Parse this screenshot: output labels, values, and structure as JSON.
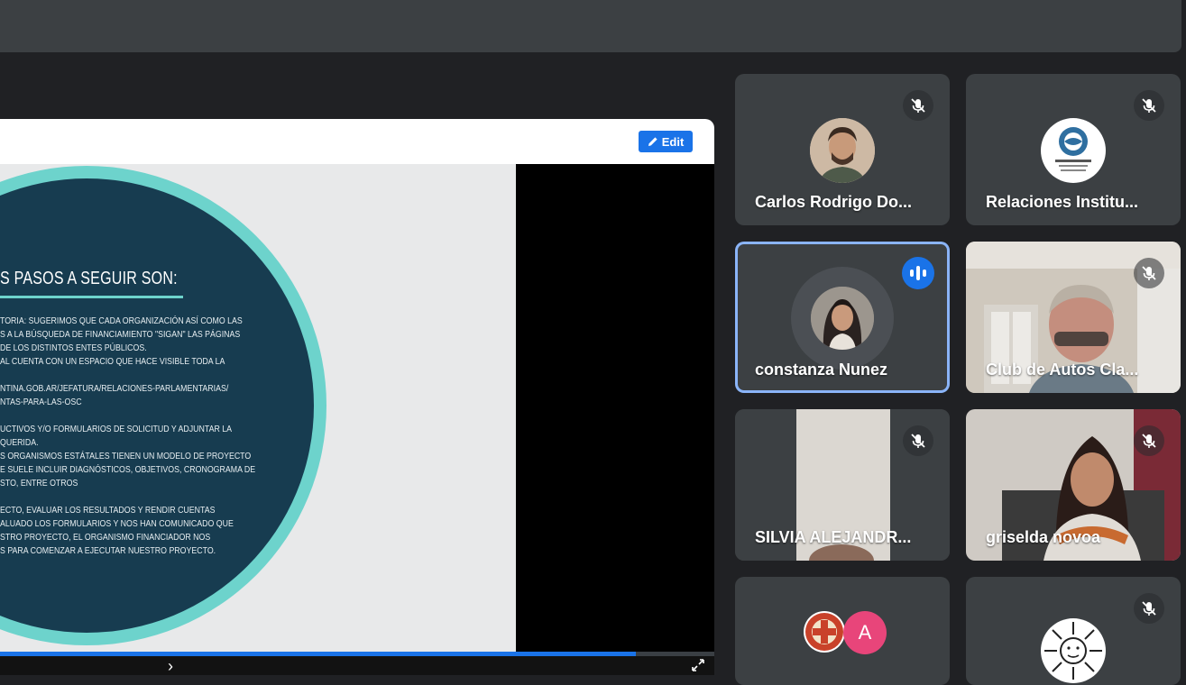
{
  "presentation": {
    "edit_label": "Edit",
    "slide_title": "S PASOS A SEGUIR SON:",
    "slide_lines": [
      "TORIA: SUGERIMOS QUE CADA ORGANIZACIÓN ASÍ COMO LAS",
      "S A LA BÚSQUEDA DE FINANCIAMIENTO \"SIGAN\" LAS PÁGINAS",
      "DE LOS DISTINTOS ENTES PÚBLICOS.",
      "AL CUENTA CON UN ESPACIO QUE HACE VISIBLE TODA LA",
      "",
      "NTINA.GOB.AR/JEFATURA/RELACIONES-PARLAMENTARIAS/",
      "NTAS-PARA-LAS-OSC",
      "",
      "UCTIVOS Y/O FORMULARIOS DE SOLICITUD Y ADJUNTAR LA",
      "QUERIDA.",
      "S ORGANISMOS ESTÁTALES TIENEN UN MODELO DE PROYECTO",
      "E SUELE INCLUIR DIAGNÓSTICOS, OBJETIVOS, CRONOGRAMA DE",
      "STO, ENTRE OTROS",
      "",
      "ECTO, EVALUAR LOS RESULTADOS Y RENDIR CUENTAS",
      "ALUADO LOS FORMULARIOS Y NOS HAN COMUNICADO QUE",
      "STRO PROYECTO, EL ORGANISMO FINANCIADOR NOS",
      "S PARA COMENZAR A EJECUTAR NUESTRO PROYECTO."
    ],
    "progress": 0.89
  },
  "participants": [
    {
      "name": "Carlos Rodrigo Do...",
      "muted": true,
      "avatar": "photo-avatar"
    },
    {
      "name": "Relaciones Institu...",
      "muted": true,
      "avatar": "logo-avatar"
    },
    {
      "name": "constanza Nunez",
      "muted": false,
      "speaking": true,
      "avatar": "photo-avatar"
    },
    {
      "name": "Club de Autos Cla...",
      "muted": true,
      "avatar": "video"
    },
    {
      "name": "SILVIA ALEJANDR...",
      "muted": true,
      "avatar": "video"
    },
    {
      "name": "griselda novoa",
      "muted": true,
      "avatar": "video"
    },
    {
      "name": "",
      "muted": false,
      "avatar": "logo-avatar",
      "initial": "A"
    },
    {
      "name": "",
      "muted": true,
      "avatar": "sun-logo-avatar"
    }
  ],
  "colors": {
    "background": "#202124",
    "tile": "#3c4043",
    "accent": "#1a73e8",
    "active_border": "#8ab4f8",
    "slide_circle": "#173c50",
    "slide_ring": "#6dd3cc"
  }
}
